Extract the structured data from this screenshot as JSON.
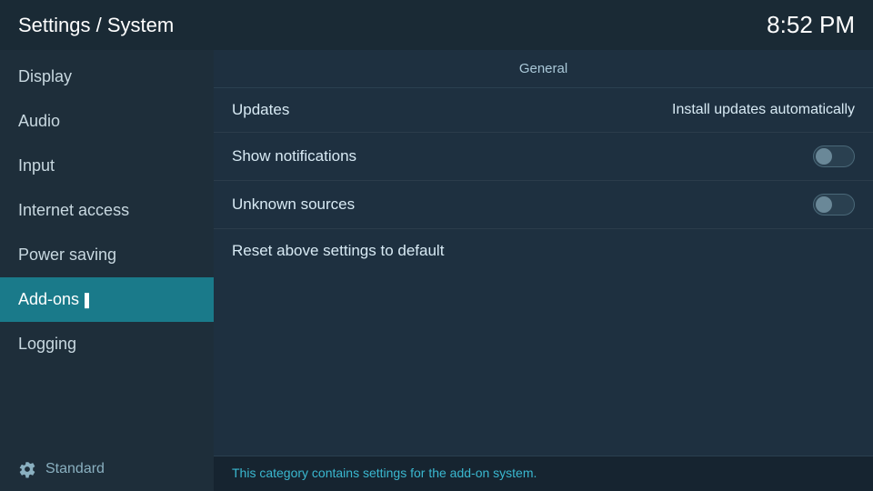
{
  "header": {
    "title": "Settings / System",
    "time": "8:52 PM"
  },
  "sidebar": {
    "items": [
      {
        "id": "display",
        "label": "Display",
        "active": false
      },
      {
        "id": "audio",
        "label": "Audio",
        "active": false
      },
      {
        "id": "input",
        "label": "Input",
        "active": false
      },
      {
        "id": "internet-access",
        "label": "Internet access",
        "active": false
      },
      {
        "id": "power-saving",
        "label": "Power saving",
        "active": false
      },
      {
        "id": "add-ons",
        "label": "Add-ons",
        "active": true
      },
      {
        "id": "logging",
        "label": "Logging",
        "active": false
      }
    ],
    "footer": {
      "icon": "gear",
      "label": "Standard"
    }
  },
  "content": {
    "section_header": "General",
    "rows": [
      {
        "id": "updates",
        "label": "Updates",
        "value": "Install updates automatically",
        "type": "text"
      },
      {
        "id": "show-notifications",
        "label": "Show notifications",
        "value": "",
        "type": "toggle",
        "toggle_on": false
      },
      {
        "id": "unknown-sources",
        "label": "Unknown sources",
        "value": "",
        "type": "toggle",
        "toggle_on": false
      },
      {
        "id": "reset",
        "label": "Reset above settings to default",
        "value": "",
        "type": "reset"
      }
    ],
    "info_text": "This category contains settings for the add-on system."
  }
}
